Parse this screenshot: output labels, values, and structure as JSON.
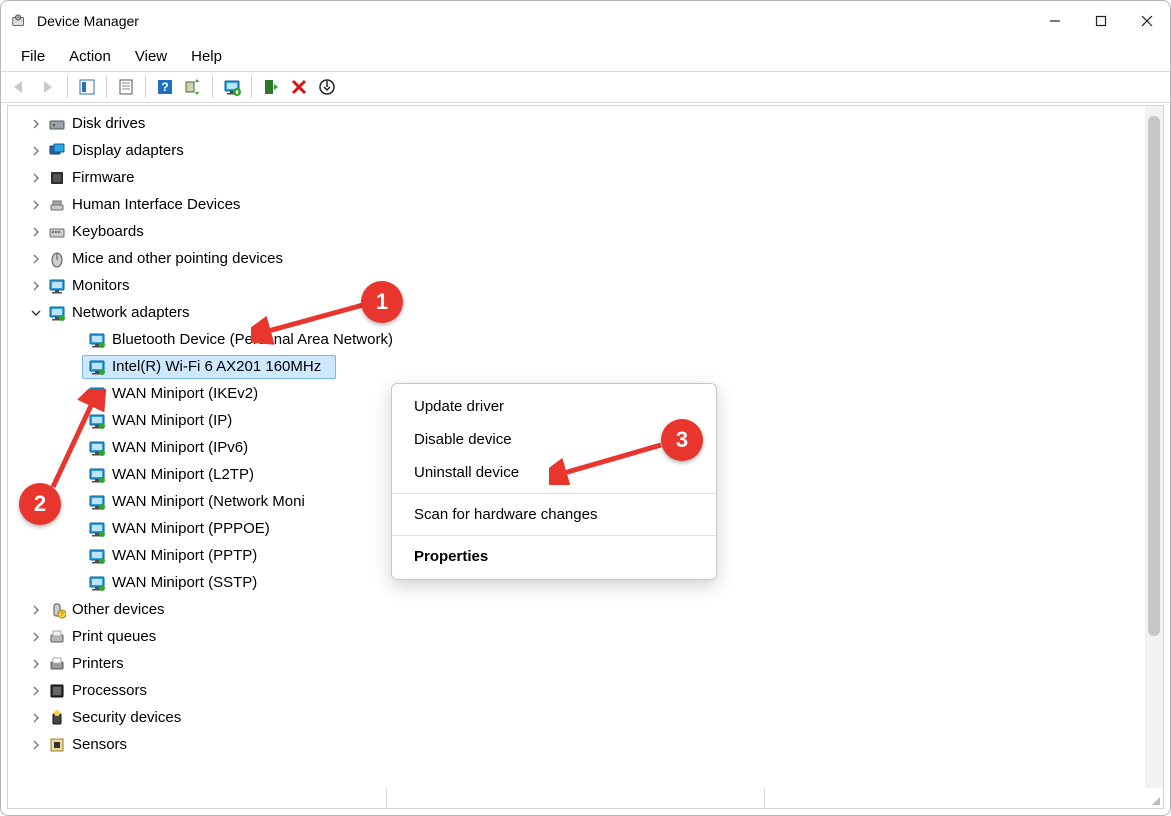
{
  "title": "Device Manager",
  "menu": [
    "File",
    "Action",
    "View",
    "Help"
  ],
  "tree": [
    {
      "label": "Disk drives",
      "icon": "disk",
      "expandable": true
    },
    {
      "label": "Display adapters",
      "icon": "display",
      "expandable": true
    },
    {
      "label": "Firmware",
      "icon": "firmware",
      "expandable": true
    },
    {
      "label": "Human Interface Devices",
      "icon": "hid",
      "expandable": true
    },
    {
      "label": "Keyboards",
      "icon": "keyboard",
      "expandable": true
    },
    {
      "label": "Mice and other pointing devices",
      "icon": "mouse",
      "expandable": true
    },
    {
      "label": "Monitors",
      "icon": "monitor",
      "expandable": true
    },
    {
      "label": "Network adapters",
      "icon": "net",
      "expandable": true,
      "expanded": true,
      "children": [
        {
          "label": "Bluetooth Device (Personal Area Network)",
          "icon": "net"
        },
        {
          "label": "Intel(R) Wi-Fi 6 AX201 160MHz",
          "icon": "net",
          "selected": true
        },
        {
          "label": "WAN Miniport (IKEv2)",
          "icon": "net"
        },
        {
          "label": "WAN Miniport (IP)",
          "icon": "net"
        },
        {
          "label": "WAN Miniport (IPv6)",
          "icon": "net"
        },
        {
          "label": "WAN Miniport (L2TP)",
          "icon": "net"
        },
        {
          "label": "WAN Miniport (Network Moni",
          "icon": "net"
        },
        {
          "label": "WAN Miniport (PPPOE)",
          "icon": "net"
        },
        {
          "label": "WAN Miniport (PPTP)",
          "icon": "net"
        },
        {
          "label": "WAN Miniport (SSTP)",
          "icon": "net"
        }
      ]
    },
    {
      "label": "Other devices",
      "icon": "other",
      "expandable": true
    },
    {
      "label": "Print queues",
      "icon": "printq",
      "expandable": true
    },
    {
      "label": "Printers",
      "icon": "printer",
      "expandable": true
    },
    {
      "label": "Processors",
      "icon": "cpu",
      "expandable": true
    },
    {
      "label": "Security devices",
      "icon": "security",
      "expandable": true
    },
    {
      "label": "Sensors",
      "icon": "sensor",
      "expandable": true
    }
  ],
  "context_menu": {
    "items": [
      {
        "label": "Update driver",
        "kind": "item"
      },
      {
        "label": "Disable device",
        "kind": "item"
      },
      {
        "label": "Uninstall device",
        "kind": "item"
      },
      {
        "kind": "sep"
      },
      {
        "label": "Scan for hardware changes",
        "kind": "item"
      },
      {
        "kind": "sep"
      },
      {
        "label": "Properties",
        "kind": "item",
        "bold": true
      }
    ]
  },
  "annotations": {
    "b1": "1",
    "b2": "2",
    "b3": "3"
  }
}
